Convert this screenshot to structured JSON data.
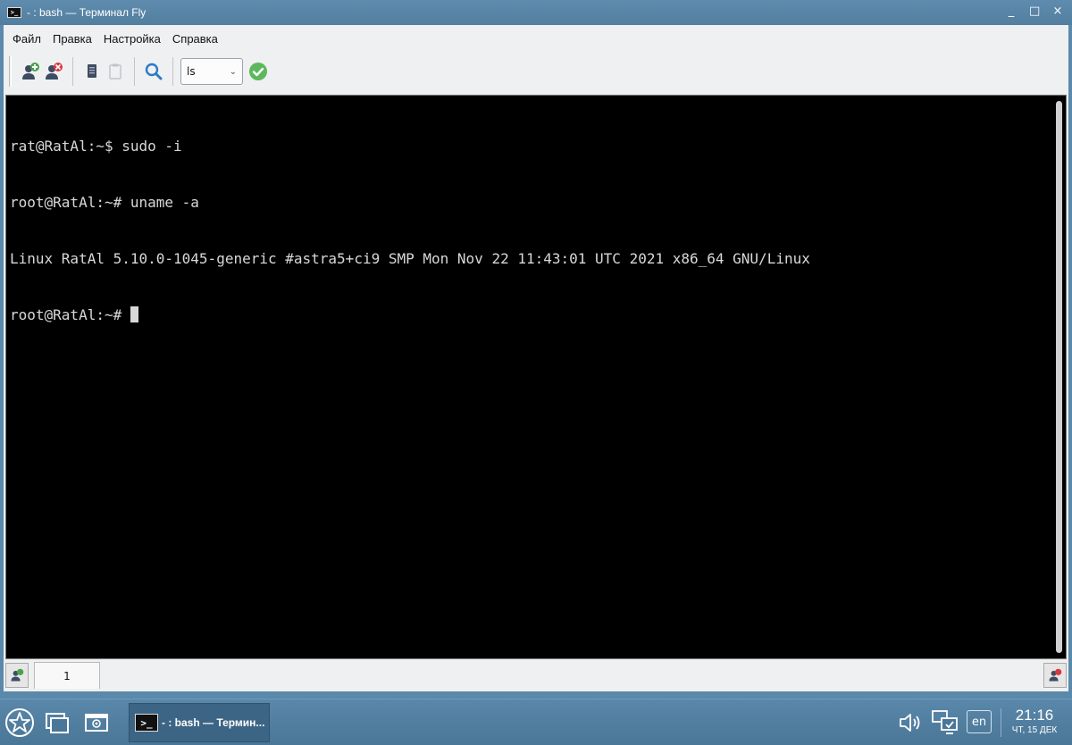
{
  "window": {
    "title": "- : bash — Терминал Fly",
    "icon": "terminal-icon",
    "controls": {
      "minimize": "_",
      "maximize": "□",
      "close": "×"
    }
  },
  "menu": {
    "items": [
      "Файл",
      "Правка",
      "Настройка",
      "Справка"
    ]
  },
  "toolbar": {
    "buttons": [
      "new-session-icon",
      "close-session-icon",
      "copy-icon",
      "paste-icon",
      "search-icon"
    ],
    "command_value": "ls",
    "run_icon": "checkmark-icon"
  },
  "terminal": {
    "lines": [
      "rat@RatAl:~$ sudo -i",
      "root@RatAl:~# uname -a",
      "Linux RatAl 5.10.0-1045-generic #astra5+ci9 SMP Mon Nov 22 11:43:01 UTC 2021 x86_64 GNU/Linux",
      "root@RatAl:~# "
    ]
  },
  "tabs": {
    "items": [
      "1"
    ]
  },
  "taskbar": {
    "task_label": "- : bash — Термин...",
    "task_icon_text": ">_",
    "language": "en",
    "time": "21:16",
    "date": "ЧТ, 15 ДЕК"
  },
  "colors": {
    "accent": "#5b89ab",
    "terminal_bg": "#000000",
    "terminal_fg": "#d8d8d8",
    "run_green": "#5cb85c"
  }
}
